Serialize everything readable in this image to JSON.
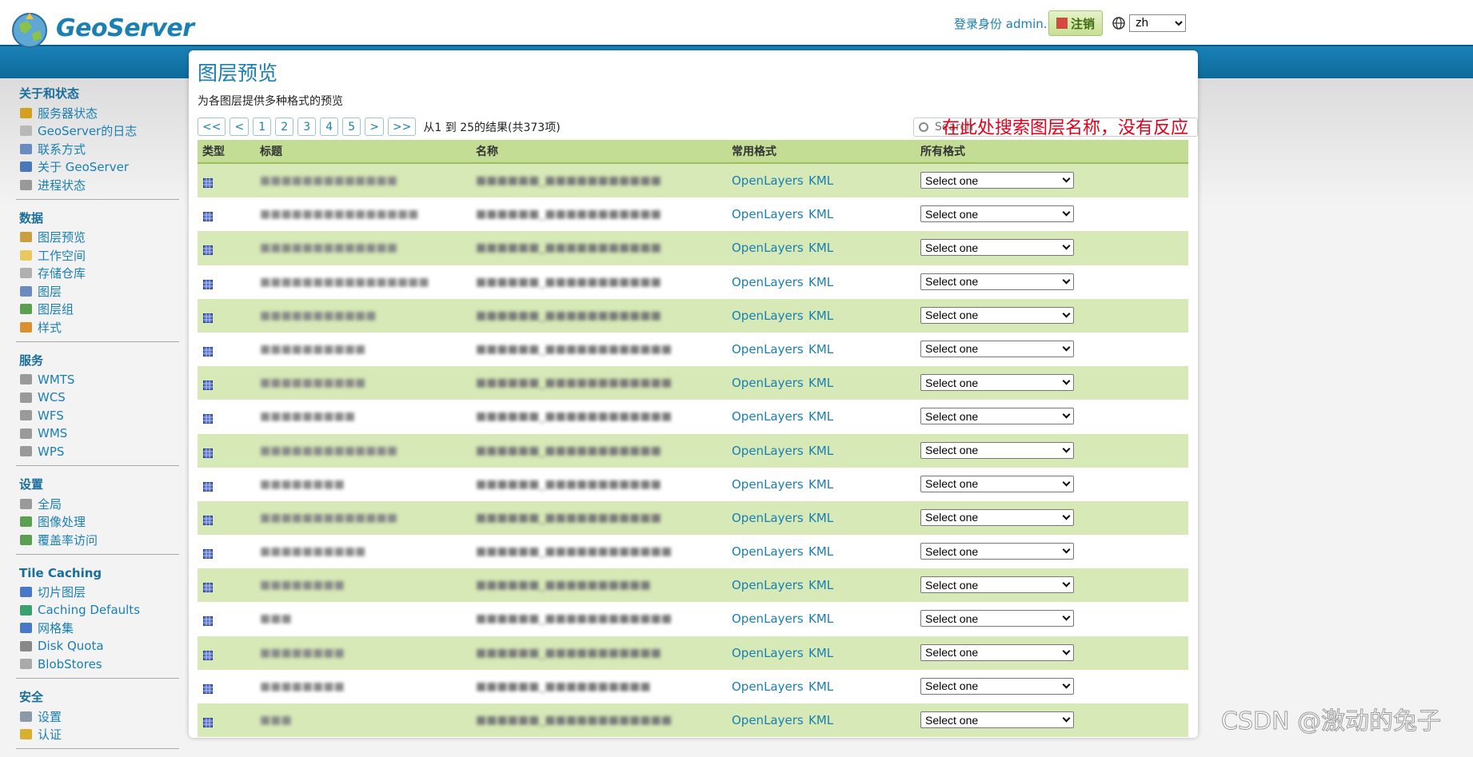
{
  "header": {
    "brand": "GeoServer",
    "login_info": "登录身份 admin.",
    "logout_label": "注销",
    "language": "zh"
  },
  "sidebar": {
    "sections": [
      {
        "title": "关于和状态",
        "items": [
          {
            "label": "服务器状态",
            "icon": "server-status-icon",
            "color": "#d4a020"
          },
          {
            "label": "GeoServer的日志",
            "icon": "log-icon",
            "color": "#b8b8b8"
          },
          {
            "label": "联系方式",
            "icon": "contact-icon",
            "color": "#6a8ac0"
          },
          {
            "label": "关于 GeoServer",
            "icon": "info-icon",
            "color": "#4a78b8"
          },
          {
            "label": "进程状态",
            "icon": "gear-icon",
            "color": "#999999"
          }
        ]
      },
      {
        "title": "数据",
        "items": [
          {
            "label": "图层预览",
            "icon": "map-preview-icon",
            "color": "#c9a040"
          },
          {
            "label": "工作空间",
            "icon": "folder-icon",
            "color": "#e9c860"
          },
          {
            "label": "存储仓库",
            "icon": "database-icon",
            "color": "#b0b0b0"
          },
          {
            "label": "图层",
            "icon": "layer-icon",
            "color": "#6a8ac0"
          },
          {
            "label": "图层组",
            "icon": "layer-group-icon",
            "color": "#5aa050"
          },
          {
            "label": "样式",
            "icon": "palette-icon",
            "color": "#d89030"
          }
        ]
      },
      {
        "title": "服务",
        "items": [
          {
            "label": "WMTS",
            "icon": "service-icon",
            "color": "#9a9a9a"
          },
          {
            "label": "WCS",
            "icon": "service-icon",
            "color": "#9a9a9a"
          },
          {
            "label": "WFS",
            "icon": "service-icon",
            "color": "#9a9a9a"
          },
          {
            "label": "WMS",
            "icon": "service-icon",
            "color": "#9a9a9a"
          },
          {
            "label": "WPS",
            "icon": "service-icon",
            "color": "#9a9a9a"
          }
        ]
      },
      {
        "title": "设置",
        "items": [
          {
            "label": "全局",
            "icon": "server-icon",
            "color": "#9a9a9a"
          },
          {
            "label": "图像处理",
            "icon": "image-icon",
            "color": "#5aa050"
          },
          {
            "label": "覆盖率访问",
            "icon": "coverage-icon",
            "color": "#5aa050"
          }
        ]
      },
      {
        "title": "Tile Caching",
        "items": [
          {
            "label": "切片图层",
            "icon": "tile-layer-icon",
            "color": "#4a78c8"
          },
          {
            "label": "Caching Defaults",
            "icon": "globe-icon",
            "color": "#3aa070"
          },
          {
            "label": "网格集",
            "icon": "grid-icon",
            "color": "#4a78c8"
          },
          {
            "label": "Disk Quota",
            "icon": "disk-icon",
            "color": "#888888"
          },
          {
            "label": "BlobStores",
            "icon": "blob-icon",
            "color": "#aaaaaa"
          }
        ]
      },
      {
        "title": "安全",
        "items": [
          {
            "label": "设置",
            "icon": "key-icon",
            "color": "#8a9aa8"
          },
          {
            "label": "认证",
            "icon": "shield-icon",
            "color": "#d8b030"
          }
        ]
      }
    ]
  },
  "main": {
    "title": "图层预览",
    "description": "为各图层提供多种格式的预览",
    "pager": {
      "first": "<<",
      "prev": "<",
      "pages": [
        "1",
        "2",
        "3",
        "4",
        "5"
      ],
      "next": ">",
      "last": ">>",
      "info": "从1 到 25的结果(共373项)"
    },
    "search_placeholder": "Search",
    "annotation": "在此处搜索图层名称，没有反应",
    "columns": {
      "type": "类型",
      "title": "标题",
      "name": "名称",
      "common_formats": "常用格式",
      "all_formats": "所有格式"
    },
    "rows": [
      {
        "title": "■■■■■■■■■■■■■",
        "name": "■■■■■■_■■■■■■■■■■■",
        "ol": "OpenLayers",
        "kml": "KML",
        "select": "Select one"
      },
      {
        "title": "■■■■■■■■■■■■■■■",
        "name": "■■■■■■_■■■■■■■■■■■",
        "ol": "OpenLayers",
        "kml": "KML",
        "select": "Select one"
      },
      {
        "title": "■■■■■■■■■■■■■",
        "name": "■■■■■■_■■■■■■■■■■■",
        "ol": "OpenLayers",
        "kml": "KML",
        "select": "Select one"
      },
      {
        "title": "■■■■■■■■■■■■■■■■",
        "name": "■■■■■■_■■■■■■■■■■■",
        "ol": "OpenLayers",
        "kml": "KML",
        "select": "Select one"
      },
      {
        "title": "■■■■■■■■■■■",
        "name": "■■■■■■_■■■■■■■■■■■",
        "ol": "OpenLayers",
        "kml": "KML",
        "select": "Select one"
      },
      {
        "title": "■■■■■■■■■■",
        "name": "■■■■■■_■■■■■■■■■■■■",
        "ol": "OpenLayers",
        "kml": "KML",
        "select": "Select one"
      },
      {
        "title": "■■■■■■■■■■",
        "name": "■■■■■■_■■■■■■■■■■■■",
        "ol": "OpenLayers",
        "kml": "KML",
        "select": "Select one"
      },
      {
        "title": "■■■■■■■■■",
        "name": "■■■■■■_■■■■■■■■■■■■",
        "ol": "OpenLayers",
        "kml": "KML",
        "select": "Select one"
      },
      {
        "title": "■■■■■■■■■■■■■",
        "name": "■■■■■■_■■■■■■■■■■■",
        "ol": "OpenLayers",
        "kml": "KML",
        "select": "Select one"
      },
      {
        "title": "■■■■■■■■",
        "name": "■■■■■■_■■■■■■■■■■■",
        "ol": "OpenLayers",
        "kml": "KML",
        "select": "Select one"
      },
      {
        "title": "■■■■■■■■■■■■■",
        "name": "■■■■■■_■■■■■■■■■■■",
        "ol": "OpenLayers",
        "kml": "KML",
        "select": "Select one"
      },
      {
        "title": "■■■■■■■■■■",
        "name": "■■■■■■_■■■■■■■■■■■■",
        "ol": "OpenLayers",
        "kml": "KML",
        "select": "Select one"
      },
      {
        "title": "■■■■■■■■",
        "name": "■■■■■■_■■■■■■■■■■",
        "ol": "OpenLayers",
        "kml": "KML",
        "select": "Select one"
      },
      {
        "title": "■■■",
        "name": "■■■■■■_■■■■■■■■■■■■",
        "ol": "OpenLayers",
        "kml": "KML",
        "select": "Select one"
      },
      {
        "title": "■■■■■■■■",
        "name": "■■■■■■_■■■■■■■■■■■",
        "ol": "OpenLayers",
        "kml": "KML",
        "select": "Select one"
      },
      {
        "title": "■■■■■■■■",
        "name": "■■■■■■_■■■■■■■■■■",
        "ol": "OpenLayers",
        "kml": "KML",
        "select": "Select one"
      },
      {
        "title": "■■■",
        "name": "■■■■■■_■■■■■■■■■■■■",
        "ol": "OpenLayers",
        "kml": "KML",
        "select": "Select one"
      }
    ]
  },
  "watermark": "CSDN @激动的兔子"
}
